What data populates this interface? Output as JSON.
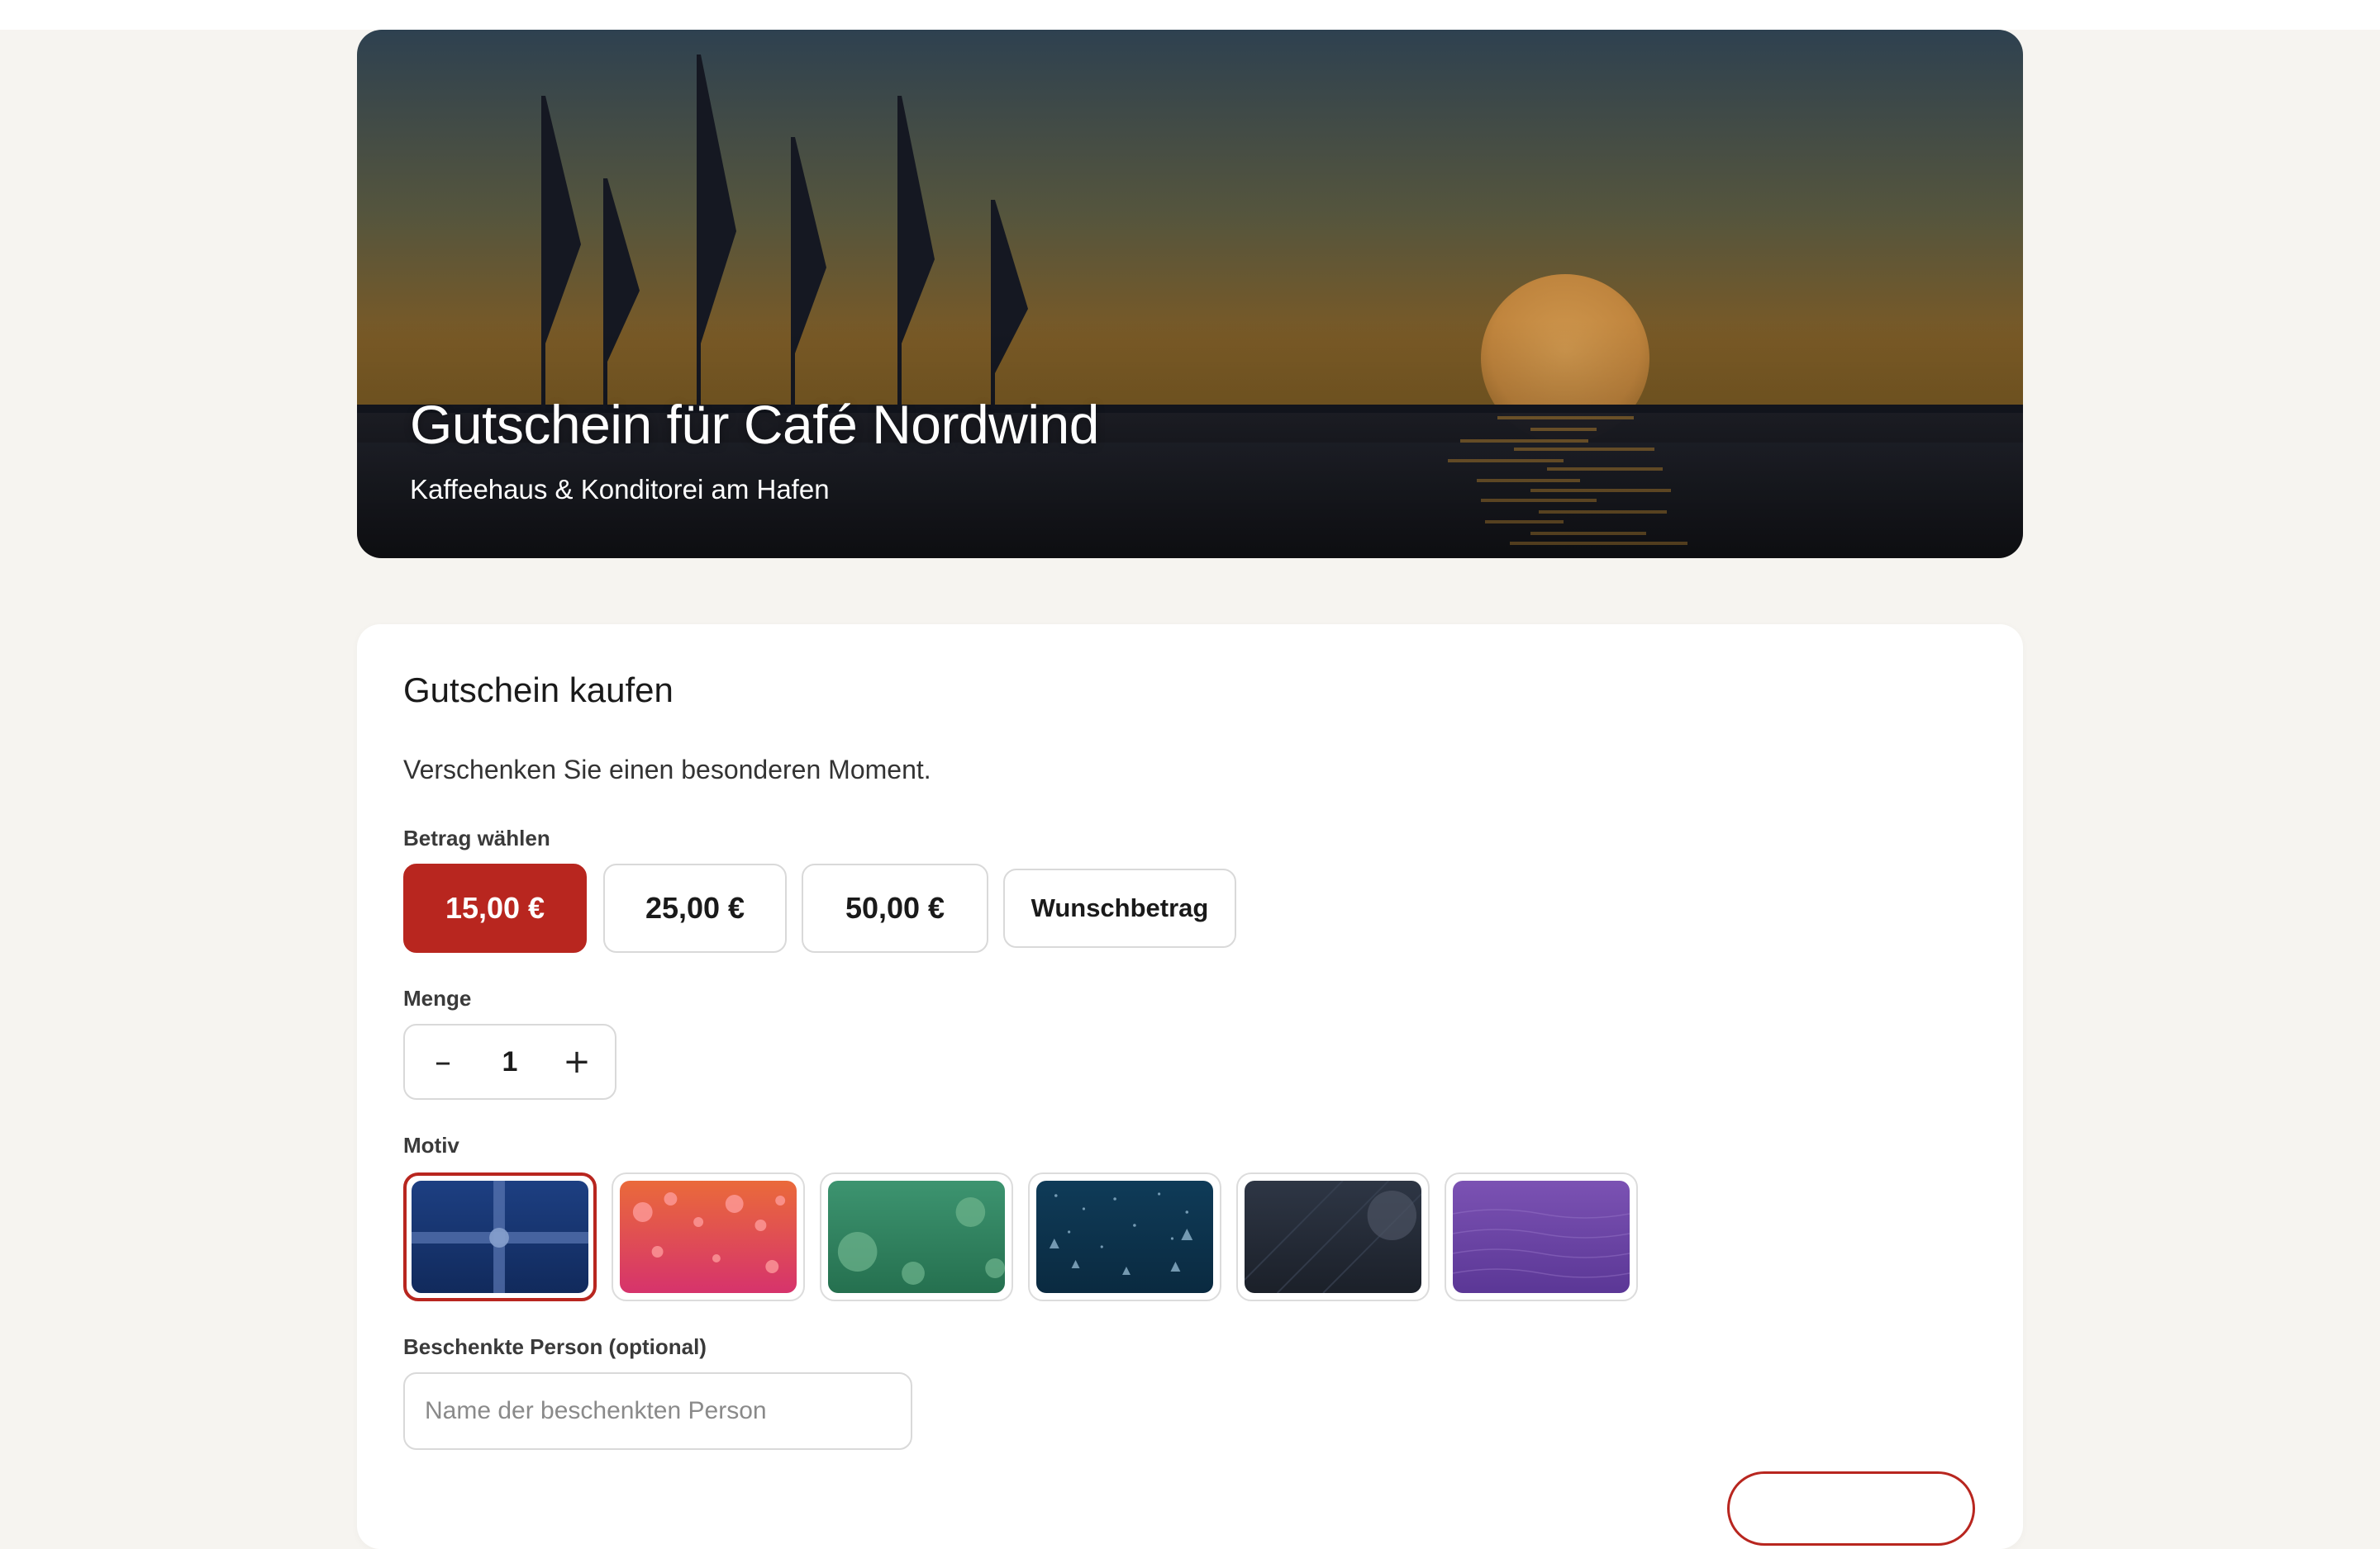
{
  "hero": {
    "title": "Gutschein für Café Nordwind",
    "subtitle": "Kaffeehaus & Konditorei am Hafen"
  },
  "card": {
    "title": "Gutschein kaufen",
    "subtitle": "Verschenken Sie einen besonderen Moment."
  },
  "amount": {
    "label": "Betrag wählen",
    "options": [
      {
        "label": "15,00 €",
        "selected": true
      },
      {
        "label": "25,00 €",
        "selected": false
      },
      {
        "label": "50,00 €",
        "selected": false
      },
      {
        "label": "Wunschbetrag",
        "selected": false
      }
    ],
    "accent_color": "#b8261f"
  },
  "quantity": {
    "label": "Menge",
    "value": "1",
    "decrement_icon": "minus-icon",
    "increment_icon": "plus-icon"
  },
  "motif": {
    "label": "Motiv",
    "options": [
      {
        "name": "ribbon-navy",
        "selected": true,
        "colors": [
          "#1d3f82",
          "#112a5c"
        ]
      },
      {
        "name": "bubbles-coral",
        "selected": false,
        "colors": [
          "#ea6a3a",
          "#d6336c"
        ]
      },
      {
        "name": "flowers-green",
        "selected": false,
        "colors": [
          "#3d9470",
          "#25704f"
        ]
      },
      {
        "name": "stars-teal",
        "selected": false,
        "colors": [
          "#0f3b58",
          "#0a2a40"
        ]
      },
      {
        "name": "moon-slate",
        "selected": false,
        "colors": [
          "#2e3645",
          "#1b2029"
        ]
      },
      {
        "name": "waves-purple",
        "selected": false,
        "colors": [
          "#7b52b3",
          "#5b3796"
        ]
      }
    ]
  },
  "recipient": {
    "label": "Beschenkte Person (optional)",
    "value": "",
    "placeholder": "Name der beschenkten Person"
  }
}
